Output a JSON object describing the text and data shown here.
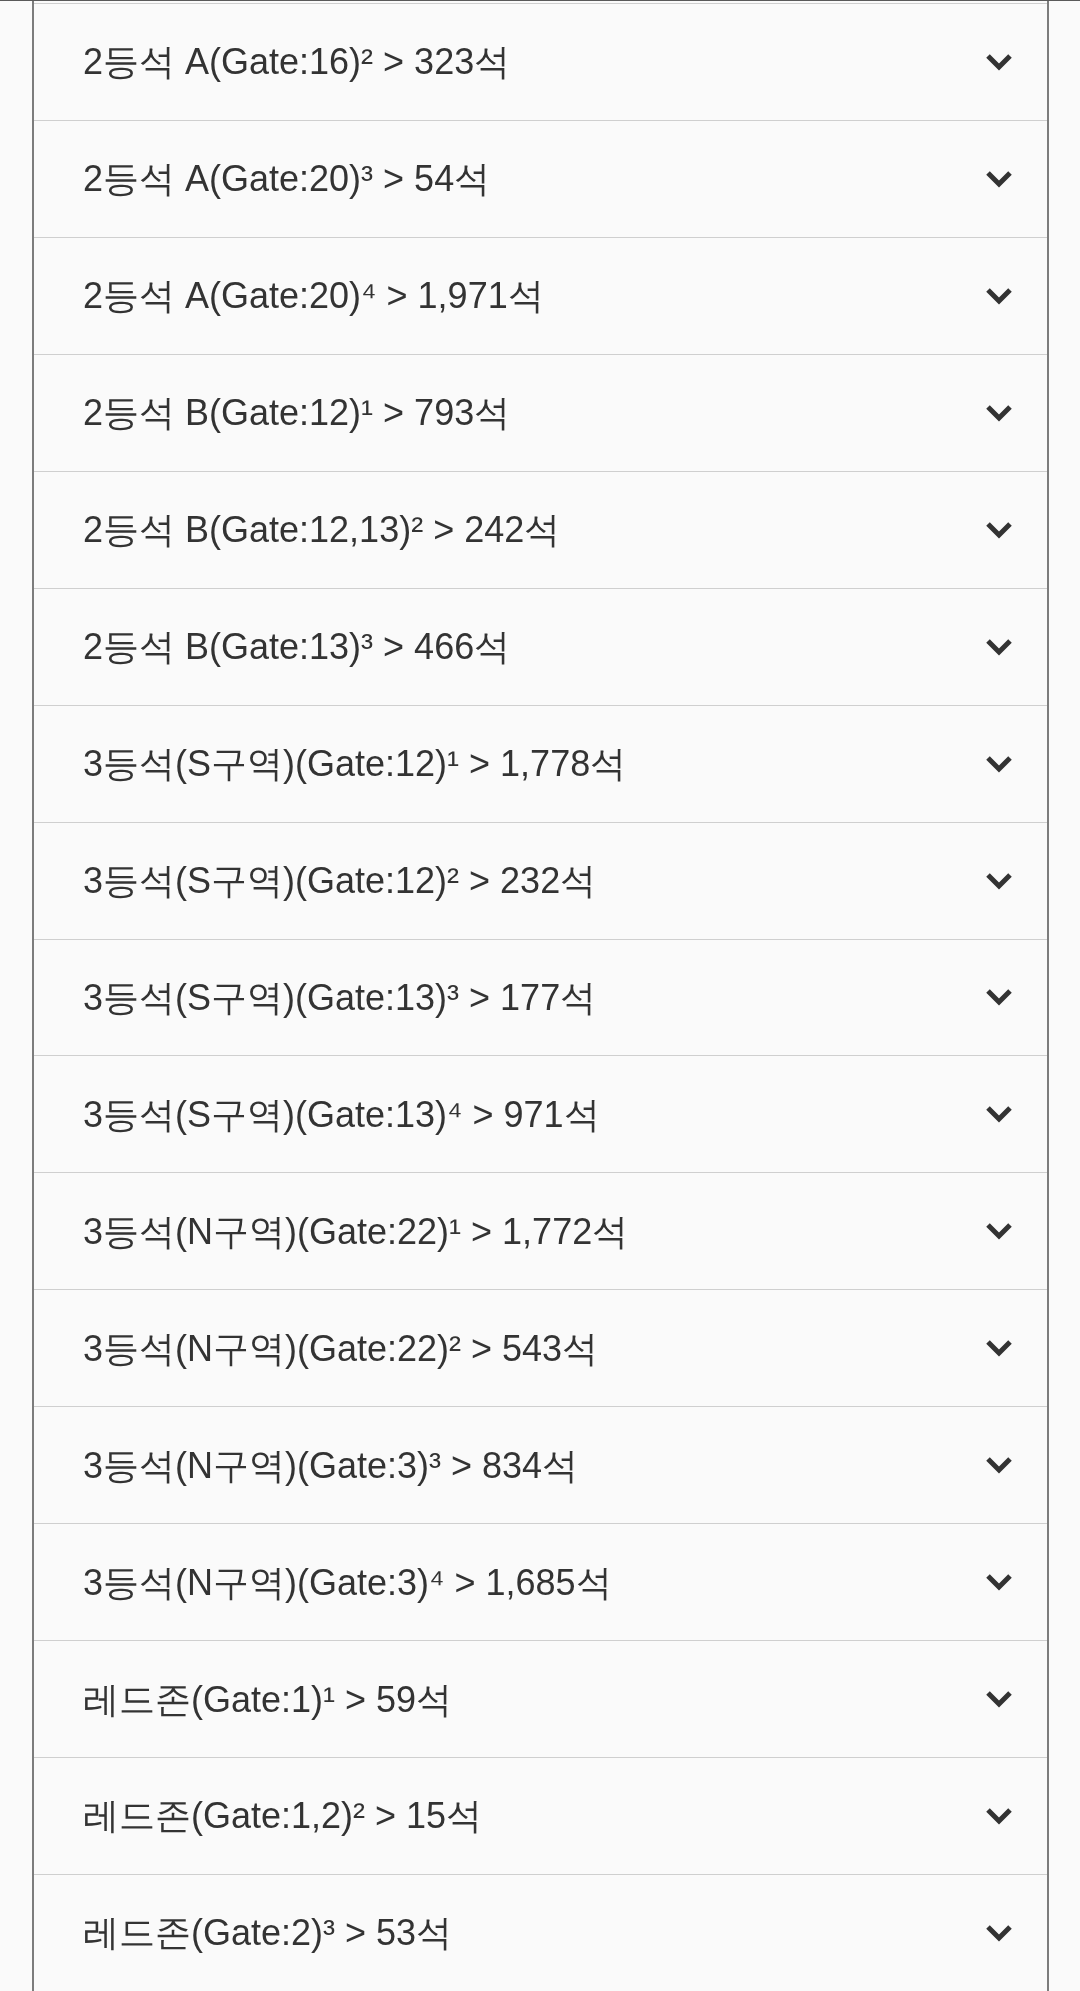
{
  "seat_sections": [
    {
      "title": "2등석 A(Gate:16)² > 323석",
      "expanded": false
    },
    {
      "title": "2등석 A(Gate:20)³ > 54석",
      "expanded": false
    },
    {
      "title": "2등석 A(Gate:20)⁴ > 1,971석",
      "expanded": false
    },
    {
      "title": "2등석 B(Gate:12)¹ > 793석",
      "expanded": false
    },
    {
      "title": "2등석 B(Gate:12,13)² > 242석",
      "expanded": false
    },
    {
      "title": "2등석 B(Gate:13)³ > 466석",
      "expanded": false
    },
    {
      "title": "3등석(S구역)(Gate:12)¹ > 1,778석",
      "expanded": false
    },
    {
      "title": "3등석(S구역)(Gate:12)² > 232석",
      "expanded": false
    },
    {
      "title": "3등석(S구역)(Gate:13)³ > 177석",
      "expanded": false
    },
    {
      "title": "3등석(S구역)(Gate:13)⁴ > 971석",
      "expanded": false
    },
    {
      "title": "3등석(N구역)(Gate:22)¹ > 1,772석",
      "expanded": false
    },
    {
      "title": "3등석(N구역)(Gate:22)² > 543석",
      "expanded": false
    },
    {
      "title": "3등석(N구역)(Gate:3)³ > 834석",
      "expanded": false
    },
    {
      "title": "3등석(N구역)(Gate:3)⁴ > 1,685석",
      "expanded": false
    },
    {
      "title": "레드존(Gate:1)¹ > 59석",
      "expanded": false
    },
    {
      "title": "레드존(Gate:1,2)² > 15석",
      "expanded": false
    },
    {
      "title": "레드존(Gate:2)³ > 53석",
      "expanded": false
    }
  ]
}
